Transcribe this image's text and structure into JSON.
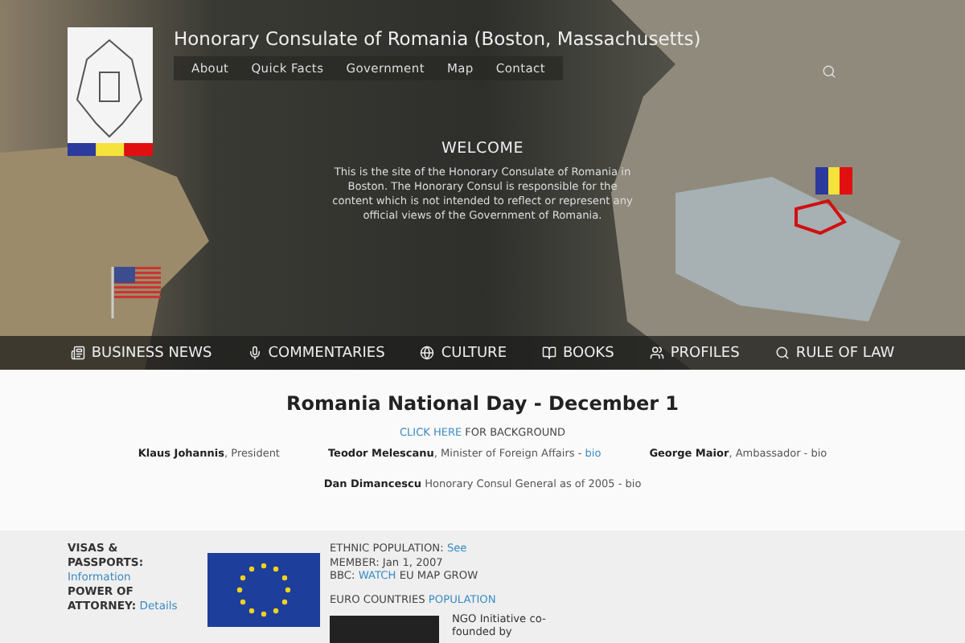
{
  "header": {
    "title": "Honorary Consulate of Romania (Boston, Massachusetts)",
    "menu": [
      "About",
      "Quick Facts",
      "Government",
      "Map",
      "Contact"
    ]
  },
  "welcome": {
    "title": "WELCOME",
    "text": "This is the site of the Honorary Consulate of Romania in Boston. The Honorary Consul is responsible for the content which is not intended to reflect or represent any official views of the Government of Romania."
  },
  "categories": [
    {
      "kind": "news",
      "label": "BUSINESS NEWS"
    },
    {
      "kind": "mic",
      "label": "COMMENTARIES"
    },
    {
      "kind": "globe",
      "label": "CULTURE"
    },
    {
      "kind": "book",
      "label": "BOOKS"
    },
    {
      "kind": "people",
      "label": "PROFILES"
    },
    {
      "kind": "search",
      "label": "RULE OF LAW"
    }
  ],
  "main": {
    "heading": "Romania National Day - December 1",
    "background_link": "CLICK HERE",
    "background_text": "FOR BACKGROUND",
    "officials": [
      {
        "name": "Klaus Johannis",
        "role": ", President"
      },
      {
        "name": "Teodor Melescanu",
        "role": ", Minister of Foreign Affairs - ",
        "link": "bio"
      },
      {
        "name": "George Maior",
        "role": ", Ambassador - bio"
      }
    ],
    "consul": {
      "name": "Dan Dimancescu",
      "role": " Honorary Consul General as of 2005 - bio"
    }
  },
  "footer": {
    "services": [
      {
        "label": "VISAS & PASSPORTS:",
        "link": "Information"
      },
      {
        "label": "POWER OF ATTORNEY:",
        "link": "Details"
      }
    ],
    "facts": [
      [
        {
          "text": "ETHNIC POPULATION: ",
          "link": false
        },
        {
          "text": "See",
          "link": true
        }
      ],
      [
        {
          "text": "MEMBER: Jan 1, 2007",
          "link": false
        }
      ],
      [
        {
          "text": "BBC: ",
          "link": false
        },
        {
          "text": "WATCH",
          "link": true
        },
        {
          "text": " EU MAP GROW",
          "link": false
        }
      ],
      [
        {
          "text": "EURO COUNTRIES ",
          "link": false
        },
        {
          "text": "POPULATION",
          "link": true
        }
      ]
    ],
    "ngo_text": "NGO Initiative co-founded by"
  }
}
